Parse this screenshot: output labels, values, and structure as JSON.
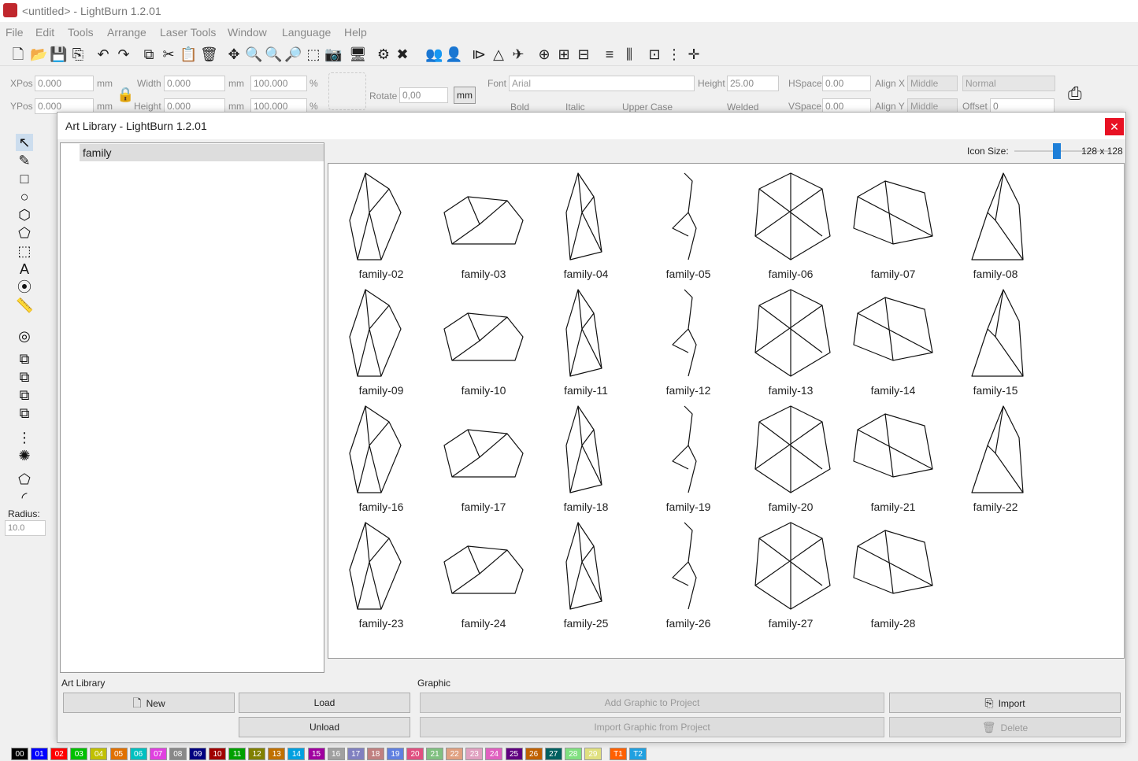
{
  "window": {
    "title": "<untitled> - LightBurn 1.2.01"
  },
  "menu": [
    "File",
    "Edit",
    "Tools",
    "Arrange",
    "Laser Tools",
    "Window",
    "Language",
    "Help"
  ],
  "props": {
    "xpos_label": "XPos",
    "xpos": "0.000",
    "ypos_label": "YPos",
    "ypos": "0.000",
    "unit_mm": "mm",
    "width_label": "Width",
    "width": "0.000",
    "height_label": "Height",
    "height": "0.000",
    "scale_w": "100.000",
    "scale_h": "100.000",
    "pct": "%",
    "rotate_label": "Rotate",
    "rotate": "0,00",
    "mm_button": "mm",
    "font_label": "Font",
    "font": "Arial",
    "fheight_label": "Height",
    "fheight": "25.00",
    "hspace_label": "HSpace",
    "hspace": "0.00",
    "vspace_label": "VSpace",
    "vspace": "0.00",
    "alignx_label": "Align X",
    "alignx": "Middle",
    "aligny_label": "Align Y",
    "aligny": "Middle",
    "normal": "Normal",
    "offset_label": "Offset",
    "offset": "0",
    "bold": "Bold",
    "italic": "Italic",
    "upper": "Upper Case",
    "welded": "Welded"
  },
  "lefttools": {
    "radius_label": "Radius:",
    "radius": "10.0"
  },
  "dialog": {
    "title": "Art Library - LightBurn 1.2.01",
    "close": "✕",
    "tree_item": "family",
    "icon_size_label": "Icon Size:",
    "icon_size_value": "128 x 128",
    "icon_size_fraction": 0.45,
    "items": [
      "family-02",
      "family-03",
      "family-04",
      "family-05",
      "family-06",
      "family-07",
      "family-08",
      "family-09",
      "family-10",
      "family-11",
      "family-12",
      "family-13",
      "family-14",
      "family-15",
      "family-16",
      "family-17",
      "family-18",
      "family-19",
      "family-20",
      "family-21",
      "family-22",
      "family-23",
      "family-24",
      "family-25",
      "family-26",
      "family-27",
      "family-28"
    ],
    "art_library_group": "Art Library",
    "graphic_group": "Graphic",
    "new": "New",
    "load": "Load",
    "unload": "Unload",
    "add_graphic": "Add Graphic to Project",
    "import_graphic": "Import Graphic from Project",
    "import": "Import",
    "delete": "Delete"
  },
  "palette": [
    {
      "label": "00",
      "color": "#000000"
    },
    {
      "label": "01",
      "color": "#0000ff"
    },
    {
      "label": "02",
      "color": "#ff0000"
    },
    {
      "label": "03",
      "color": "#00c000"
    },
    {
      "label": "04",
      "color": "#c0c000"
    },
    {
      "label": "05",
      "color": "#e07000"
    },
    {
      "label": "06",
      "color": "#00c0c0"
    },
    {
      "label": "07",
      "color": "#e040e0"
    },
    {
      "label": "08",
      "color": "#888888"
    },
    {
      "label": "09",
      "color": "#000080"
    },
    {
      "label": "10",
      "color": "#a00000"
    },
    {
      "label": "11",
      "color": "#00a000"
    },
    {
      "label": "12",
      "color": "#808000"
    },
    {
      "label": "13",
      "color": "#c07000"
    },
    {
      "label": "14",
      "color": "#00a0e0"
    },
    {
      "label": "15",
      "color": "#a000a0"
    },
    {
      "label": "16",
      "color": "#a0a0a0"
    },
    {
      "label": "17",
      "color": "#8080c0"
    },
    {
      "label": "18",
      "color": "#c08080"
    },
    {
      "label": "19",
      "color": "#6080e0"
    },
    {
      "label": "20",
      "color": "#e05080"
    },
    {
      "label": "21",
      "color": "#80c080"
    },
    {
      "label": "22",
      "color": "#e0a080"
    },
    {
      "label": "23",
      "color": "#e0a0c0"
    },
    {
      "label": "24",
      "color": "#e060c0"
    },
    {
      "label": "25",
      "color": "#600080"
    },
    {
      "label": "26",
      "color": "#c06000"
    },
    {
      "label": "27",
      "color": "#006060"
    },
    {
      "label": "28",
      "color": "#80e080"
    },
    {
      "label": "29",
      "color": "#e0e080"
    },
    {
      "label": "T1",
      "color": "#ff6000"
    },
    {
      "label": "T2",
      "color": "#20a0e0"
    }
  ]
}
